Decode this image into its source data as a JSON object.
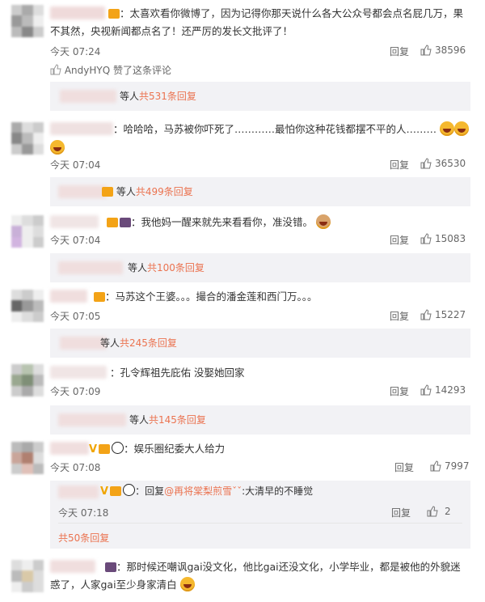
{
  "comments": [
    {
      "text": "：太喜欢看你微博了，因为记得你那天说什么各大公众号都会点名屁几万，果不其然，央视新闻都点名了！还严厉的发长文批评了！",
      "time": "今天 07:24",
      "reply": "回复",
      "likes": "38596",
      "liked_by": "AndyHYQ 赞了这条评论",
      "sub_prefix": "等人",
      "sub_count": "共531条回复"
    },
    {
      "text": "：哈哈哈，马苏被你吓死了…………最怕你这种花钱都摆不平的人………",
      "time": "今天 07:04",
      "reply": "回复",
      "likes": "36530",
      "sub_prefix": "等人",
      "sub_count": "共499条回复"
    },
    {
      "text": "：我他妈一醒来就先来看看你，准没错。",
      "time": "今天 07:04",
      "reply": "回复",
      "likes": "15083",
      "sub_prefix": "等人",
      "sub_count": "共100条回复"
    },
    {
      "text": "：马苏这个王婆。。。撮合的潘金莲和西门万。。。",
      "time": "今天 07:05",
      "reply": "回复",
      "likes": "15227",
      "sub_prefix": "等人",
      "sub_count": "共245条回复"
    },
    {
      "text": "：孔令辉祖先庇佑 没娶她回家",
      "time": "今天 07:09",
      "reply": "回复",
      "likes": "14293",
      "sub_prefix": "等人",
      "sub_count": "共145条回复"
    },
    {
      "text": "：娱乐圈纪委大人给力",
      "time": "今天 07:08",
      "reply": "回复",
      "likes": "7997",
      "subreply": {
        "prefix": "：回复",
        "mention": "@再将棠梨煎雪ˇˇ",
        "text": ":大清早的不睡觉",
        "time": "今天 07:18",
        "reply": "回复",
        "likes": "2"
      },
      "sub_count": "共50条回复"
    },
    {
      "text": "：那时候还嘲讽gai没文化，他比gai还没文化，小学毕业，都是被他的外貌迷惑了，人家gai至少身家清白"
    }
  ],
  "colors": {
    "accent": "#eb7350",
    "reply_bg": "#f2f2f5"
  },
  "icons": {
    "like": "thumb-up-icon",
    "emoji": "laughing-emoji-icon"
  }
}
